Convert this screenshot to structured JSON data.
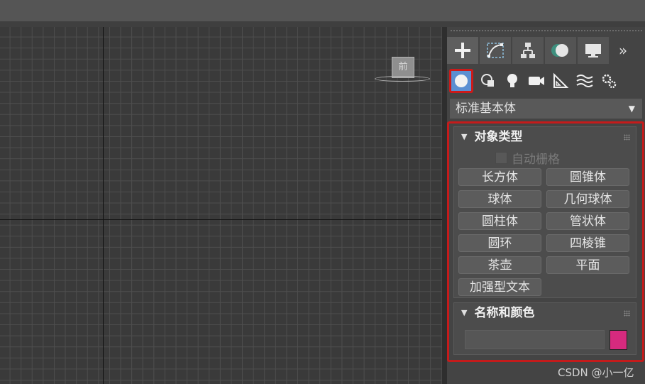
{
  "viewport": {
    "viewcube_label": "前"
  },
  "command_panel": {
    "tabs": [
      {
        "name": "create",
        "icon": "plus-icon"
      },
      {
        "name": "modify",
        "icon": "curve-modify-icon"
      },
      {
        "name": "hierarchy",
        "icon": "hierarchy-icon"
      },
      {
        "name": "motion",
        "icon": "motion-icon"
      },
      {
        "name": "display",
        "icon": "monitor-icon"
      }
    ],
    "more_label": "»",
    "subcategories": [
      "geometry-icon",
      "shapes-icon",
      "lights-icon",
      "cameras-icon",
      "helpers-icon",
      "space-warps-icon",
      "systems-icon"
    ],
    "category_dropdown": {
      "selected": "标准基本体"
    },
    "object_type": {
      "title": "对象类型",
      "autogrid_label": "自动栅格",
      "buttons": [
        "长方体",
        "圆锥体",
        "球体",
        "几何球体",
        "圆柱体",
        "管状体",
        "圆环",
        "四棱锥",
        "茶壶",
        "平面",
        "加强型文本"
      ]
    },
    "name_color": {
      "title": "名称和颜色",
      "name_value": "",
      "swatch_color": "#d62a7e"
    }
  },
  "watermark": "CSDN @小一亿",
  "colors": {
    "highlight_frame": "#c41b1b",
    "selected_icon_bg": "#5b8fd2"
  }
}
